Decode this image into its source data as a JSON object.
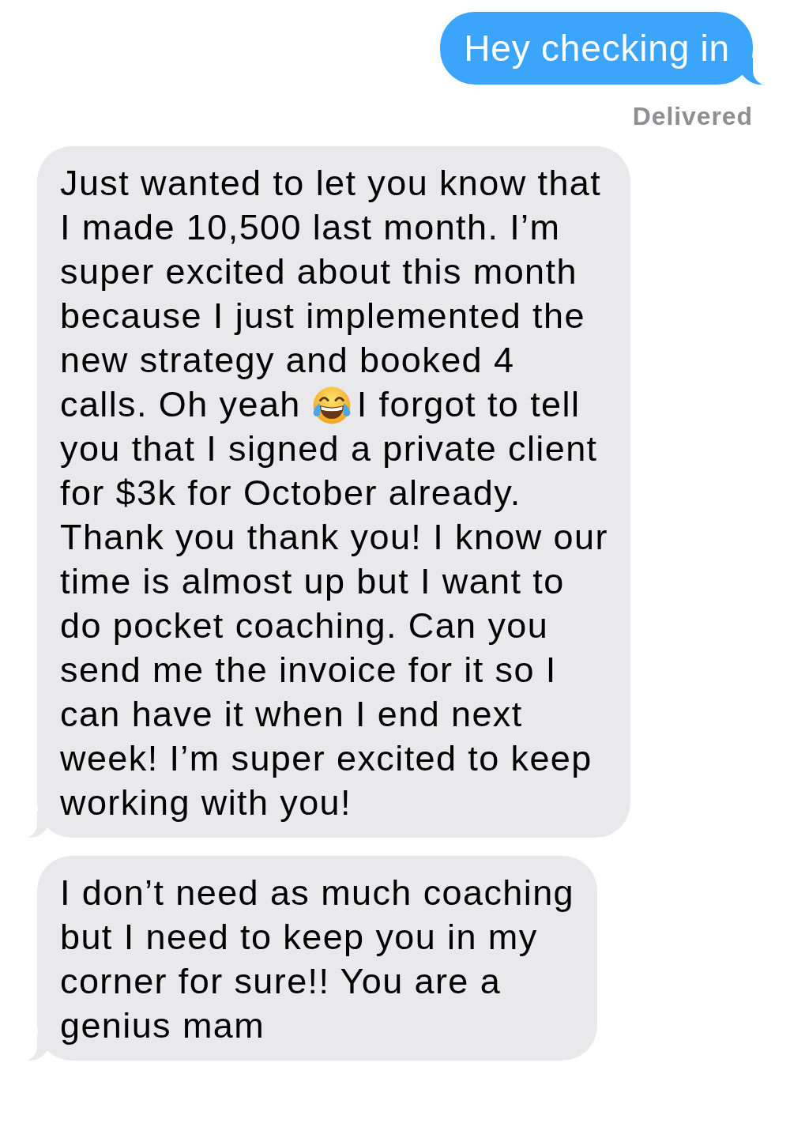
{
  "messages": [
    {
      "kind": "sent",
      "text": "Hey checking in",
      "status": "Delivered"
    },
    {
      "kind": "received",
      "segments": [
        {
          "kind": "text",
          "text": "Just wanted to let you know that I made 10,500 last month. I’m super excited about this month because I just implemented the new strategy and booked 4 calls. Oh yeah"
        },
        {
          "kind": "emoji"
        },
        {
          "kind": "text",
          "text": "I forgot to tell you that I signed a private client for $3k for October already. Thank you thank you! I know our time is almost up but I want to do pocket coaching. Can you send me the invoice for it so I can have it when I end next week! I’m super excited to keep working with you!"
        }
      ]
    },
    {
      "kind": "received",
      "segments": [
        {
          "kind": "text",
          "text": "I don’t need as much coaching but I need to keep you in my corner for sure!! You are a genius mam"
        }
      ]
    }
  ]
}
